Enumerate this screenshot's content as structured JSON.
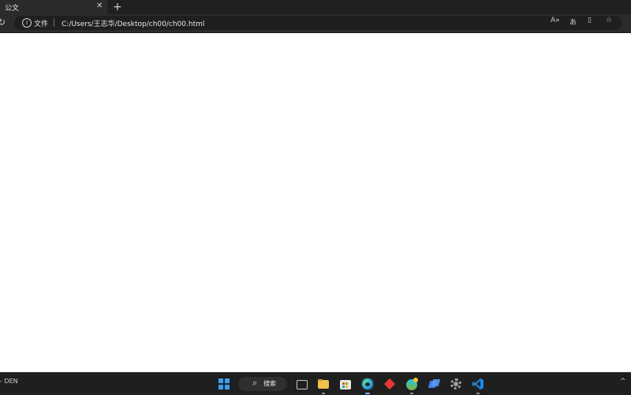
{
  "browser": {
    "tab": {
      "title": "公文",
      "close_glyph": "✕"
    },
    "new_tab_glyph": "+",
    "toolbar": {
      "refresh_glyph": "↻",
      "info_glyph": "i",
      "security_label": "文件",
      "url": "C:/Users/王志华/Desktop/ch00/ch00.html",
      "icons": {
        "read_aloud": "A»",
        "translate": "あ",
        "split_screen": "▯",
        "favorites": "☆"
      }
    }
  },
  "taskbar": {
    "weather_text": "- DEN",
    "search": {
      "label": "搜索",
      "icon_glyph": "⌕"
    },
    "tray_glyph": "^",
    "apps": [
      {
        "name": "task-view-icon",
        "color": "#c8c8c8"
      },
      {
        "name": "file-explorer-icon",
        "color": "#f0c24a"
      },
      {
        "name": "store-icon",
        "color": "#e0e0e0"
      },
      {
        "name": "edge-icon",
        "color": "#2ea7e0"
      },
      {
        "name": "red-app-icon",
        "color": "#e53935"
      },
      {
        "name": "colorful-app-icon",
        "color": "#26c6da"
      },
      {
        "name": "blue-app-icon",
        "color": "#3f7de6"
      },
      {
        "name": "settings-icon",
        "color": "#9aa0a6"
      },
      {
        "name": "vscode-icon",
        "color": "#1e88e5"
      }
    ]
  }
}
